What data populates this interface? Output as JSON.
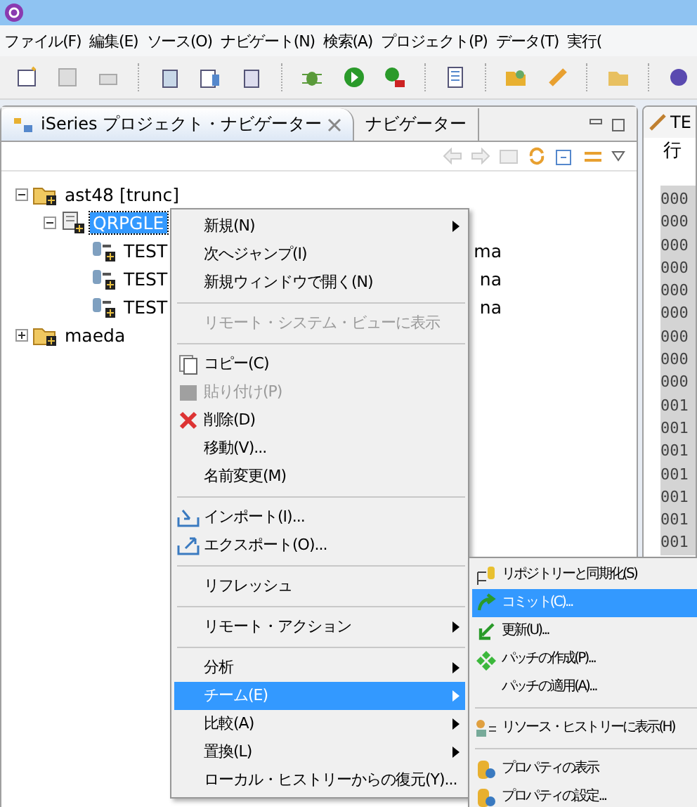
{
  "menubar": [
    "ファイル(F)",
    "編集(E)",
    "ソース(O)",
    "ナビゲート(N)",
    "検索(A)",
    "プロジェクト(P)",
    "データ(T)",
    "実行("
  ],
  "view": {
    "tabs": [
      {
        "label": "iSeries プロジェクト・ナビゲーター",
        "selected": true
      },
      {
        "label": "ナビゲーター",
        "selected": false
      }
    ]
  },
  "tree": [
    {
      "label": "ast48 [trunc]",
      "expanded": true,
      "selected": false,
      "children": [
        {
          "label": "QRPGLE",
          "expanded": true,
          "selected": true,
          "children": [
            {
              "label": "TEST",
              "tail": "ma"
            },
            {
              "label": "TEST",
              "tail": "na"
            },
            {
              "label": "TEST",
              "tail": "na"
            }
          ]
        }
      ]
    },
    {
      "label": "maeda",
      "expanded": false,
      "selected": false
    }
  ],
  "editor": {
    "tab": "TE",
    "header": "行",
    "lines": [
      "000",
      "000",
      "000",
      "000",
      "000",
      "000",
      "000",
      "000",
      "000",
      "001",
      "001",
      "001",
      "001",
      "001",
      "001",
      "001"
    ]
  },
  "context_menu": [
    {
      "kind": "item",
      "label": "新規(N)",
      "submenu": true,
      "disabled": false,
      "selected": false
    },
    {
      "kind": "item",
      "label": "次へジャンプ(I)",
      "submenu": false,
      "disabled": false,
      "selected": false
    },
    {
      "kind": "item",
      "label": "新規ウィンドウで開く(N)",
      "submenu": false,
      "disabled": false,
      "selected": false
    },
    {
      "kind": "separator"
    },
    {
      "kind": "item",
      "label": "リモート・システム・ビューに表示",
      "submenu": false,
      "disabled": true,
      "selected": false
    },
    {
      "kind": "separator"
    },
    {
      "kind": "item",
      "label": "コピー(C)",
      "submenu": false,
      "disabled": false,
      "selected": false
    },
    {
      "kind": "item",
      "label": "貼り付け(P)",
      "submenu": false,
      "disabled": true,
      "selected": false
    },
    {
      "kind": "item",
      "label": "削除(D)",
      "submenu": false,
      "disabled": false,
      "selected": false
    },
    {
      "kind": "item",
      "label": "移動(V)...",
      "submenu": false,
      "disabled": false,
      "selected": false
    },
    {
      "kind": "item",
      "label": "名前変更(M)",
      "submenu": false,
      "disabled": false,
      "selected": false
    },
    {
      "kind": "separator"
    },
    {
      "kind": "item",
      "label": "インポート(I)...",
      "submenu": false,
      "disabled": false,
      "selected": false
    },
    {
      "kind": "item",
      "label": "エクスポート(O)...",
      "submenu": false,
      "disabled": false,
      "selected": false
    },
    {
      "kind": "separator"
    },
    {
      "kind": "item",
      "label": "リフレッシュ",
      "submenu": false,
      "disabled": false,
      "selected": false
    },
    {
      "kind": "separator"
    },
    {
      "kind": "item",
      "label": "リモート・アクション",
      "submenu": true,
      "disabled": false,
      "selected": false
    },
    {
      "kind": "separator"
    },
    {
      "kind": "item",
      "label": "分析",
      "submenu": true,
      "disabled": false,
      "selected": false
    },
    {
      "kind": "item",
      "label": "チーム(E)",
      "submenu": true,
      "disabled": false,
      "selected": true
    },
    {
      "kind": "item",
      "label": "比較(A)",
      "submenu": true,
      "disabled": false,
      "selected": false
    },
    {
      "kind": "item",
      "label": "置換(L)",
      "submenu": true,
      "disabled": false,
      "selected": false
    },
    {
      "kind": "item",
      "label": "ローカル・ヒストリーからの復元(Y)...",
      "submenu": false,
      "disabled": false,
      "selected": false
    }
  ],
  "team_submenu": [
    {
      "kind": "item",
      "label": "リポジトリーと同期化(S)",
      "selected": false
    },
    {
      "kind": "item",
      "label": "コミット(C)...",
      "selected": true
    },
    {
      "kind": "item",
      "label": "更新(U)...",
      "selected": false
    },
    {
      "kind": "item",
      "label": "パッチの作成(P)...",
      "selected": false
    },
    {
      "kind": "item",
      "label": "パッチの適用(A)...",
      "selected": false
    },
    {
      "kind": "separator"
    },
    {
      "kind": "item",
      "label": "リソース・ヒストリーに表示(H)",
      "selected": false
    },
    {
      "kind": "separator"
    },
    {
      "kind": "item",
      "label": "プロパティの表示",
      "selected": false
    },
    {
      "kind": "item",
      "label": "プロパティの設定...",
      "selected": false
    }
  ]
}
